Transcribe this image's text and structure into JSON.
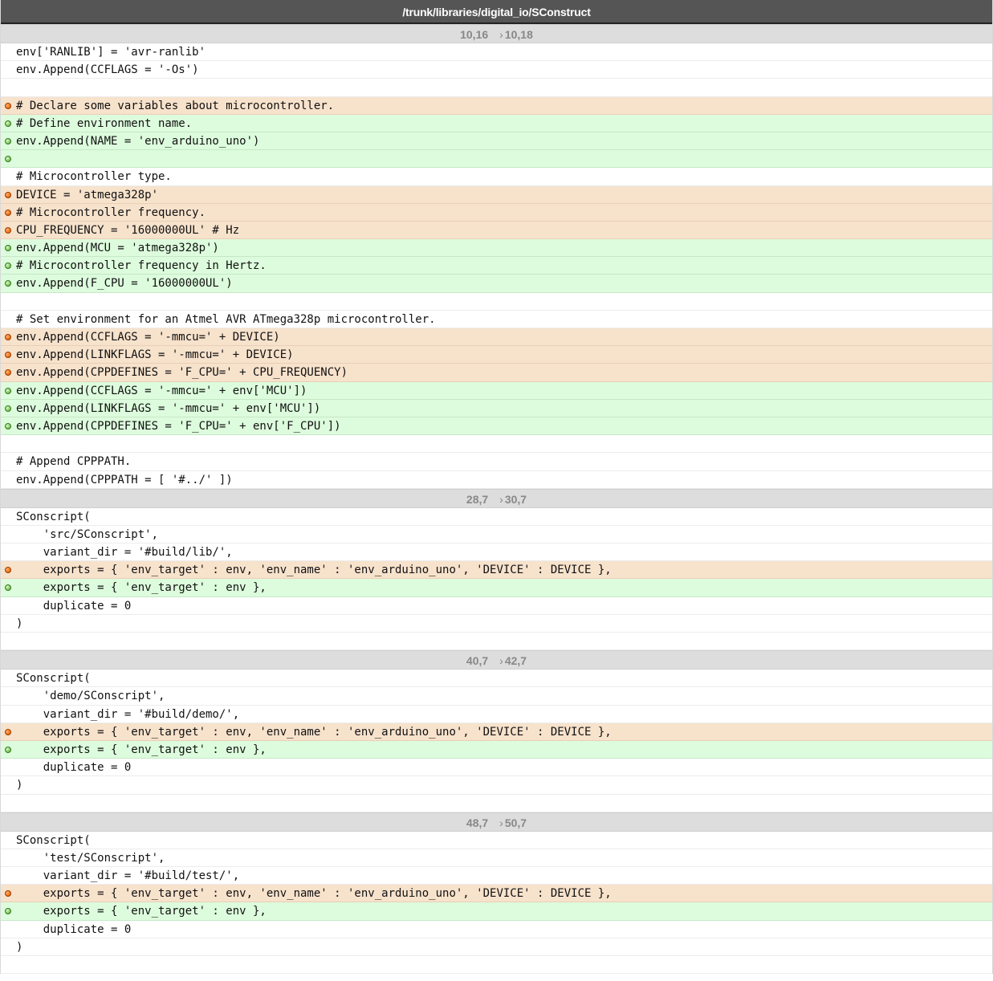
{
  "title": "/trunk/libraries/digital_io/SConstruct",
  "hunks": [
    {
      "old": "10,16",
      "new": "10,18",
      "lines": [
        {
          "type": "ctx",
          "text": "env['RANLIB'] = 'avr-ranlib'"
        },
        {
          "type": "ctx",
          "text": "env.Append(CCFLAGS = '-Os')"
        },
        {
          "type": "ctx",
          "text": ""
        },
        {
          "type": "del",
          "text": "# Declare some variables about microcontroller."
        },
        {
          "type": "add",
          "text": "# Define environment name."
        },
        {
          "type": "add",
          "text": "env.Append(NAME = 'env_arduino_uno')"
        },
        {
          "type": "add",
          "text": ""
        },
        {
          "type": "ctx",
          "text": "# Microcontroller type."
        },
        {
          "type": "del",
          "text": "DEVICE = 'atmega328p'"
        },
        {
          "type": "del",
          "text": "# Microcontroller frequency."
        },
        {
          "type": "del",
          "text": "CPU_FREQUENCY = '16000000UL' # Hz"
        },
        {
          "type": "add",
          "text": "env.Append(MCU = 'atmega328p')"
        },
        {
          "type": "add",
          "text": "# Microcontroller frequency in Hertz."
        },
        {
          "type": "add",
          "text": "env.Append(F_CPU = '16000000UL')"
        },
        {
          "type": "ctx",
          "text": ""
        },
        {
          "type": "ctx",
          "text": "# Set environment for an Atmel AVR ATmega328p microcontroller."
        },
        {
          "type": "del",
          "text": "env.Append(CCFLAGS = '-mmcu=' + DEVICE)"
        },
        {
          "type": "del",
          "text": "env.Append(LINKFLAGS = '-mmcu=' + DEVICE)"
        },
        {
          "type": "del",
          "text": "env.Append(CPPDEFINES = 'F_CPU=' + CPU_FREQUENCY)"
        },
        {
          "type": "add",
          "text": "env.Append(CCFLAGS = '-mmcu=' + env['MCU'])"
        },
        {
          "type": "add",
          "text": "env.Append(LINKFLAGS = '-mmcu=' + env['MCU'])"
        },
        {
          "type": "add",
          "text": "env.Append(CPPDEFINES = 'F_CPU=' + env['F_CPU'])"
        },
        {
          "type": "ctx",
          "text": ""
        },
        {
          "type": "ctx",
          "text": "# Append CPPPATH."
        },
        {
          "type": "ctx",
          "text": "env.Append(CPPPATH = [ '#../' ])"
        }
      ]
    },
    {
      "old": "28,7",
      "new": "30,7",
      "lines": [
        {
          "type": "ctx",
          "text": "SConscript("
        },
        {
          "type": "ctx",
          "text": "    'src/SConscript',"
        },
        {
          "type": "ctx",
          "text": "    variant_dir = '#build/lib/',"
        },
        {
          "type": "del",
          "text": "    exports = { 'env_target' : env, 'env_name' : 'env_arduino_uno', 'DEVICE' : DEVICE },"
        },
        {
          "type": "add",
          "text": "    exports = { 'env_target' : env },"
        },
        {
          "type": "ctx",
          "text": "    duplicate = 0"
        },
        {
          "type": "ctx",
          "text": ")"
        },
        {
          "type": "ctx",
          "text": ""
        }
      ]
    },
    {
      "old": "40,7",
      "new": "42,7",
      "lines": [
        {
          "type": "ctx",
          "text": "SConscript("
        },
        {
          "type": "ctx",
          "text": "    'demo/SConscript',"
        },
        {
          "type": "ctx",
          "text": "    variant_dir = '#build/demo/',"
        },
        {
          "type": "del",
          "text": "    exports = { 'env_target' : env, 'env_name' : 'env_arduino_uno', 'DEVICE' : DEVICE },"
        },
        {
          "type": "add",
          "text": "    exports = { 'env_target' : env },"
        },
        {
          "type": "ctx",
          "text": "    duplicate = 0"
        },
        {
          "type": "ctx",
          "text": ")"
        },
        {
          "type": "ctx",
          "text": ""
        }
      ]
    },
    {
      "old": "48,7",
      "new": "50,7",
      "lines": [
        {
          "type": "ctx",
          "text": "SConscript("
        },
        {
          "type": "ctx",
          "text": "    'test/SConscript',"
        },
        {
          "type": "ctx",
          "text": "    variant_dir = '#build/test/',"
        },
        {
          "type": "del",
          "text": "    exports = { 'env_target' : env, 'env_name' : 'env_arduino_uno', 'DEVICE' : DEVICE },"
        },
        {
          "type": "add",
          "text": "    exports = { 'env_target' : env },"
        },
        {
          "type": "ctx",
          "text": "    duplicate = 0"
        },
        {
          "type": "ctx",
          "text": ")"
        },
        {
          "type": "ctx",
          "text": ""
        }
      ]
    }
  ],
  "hunk_arrow": "›",
  "marker_icons": {
    "del": "removed-line-icon",
    "add": "added-line-icon"
  },
  "colors": {
    "title_bg": "#555555",
    "hunk_bg": "#dddddd",
    "del_bg": "#f7e2cc",
    "add_bg": "#ddfcdd",
    "del_marker": "#f07820",
    "add_marker": "#8ccf6a"
  }
}
